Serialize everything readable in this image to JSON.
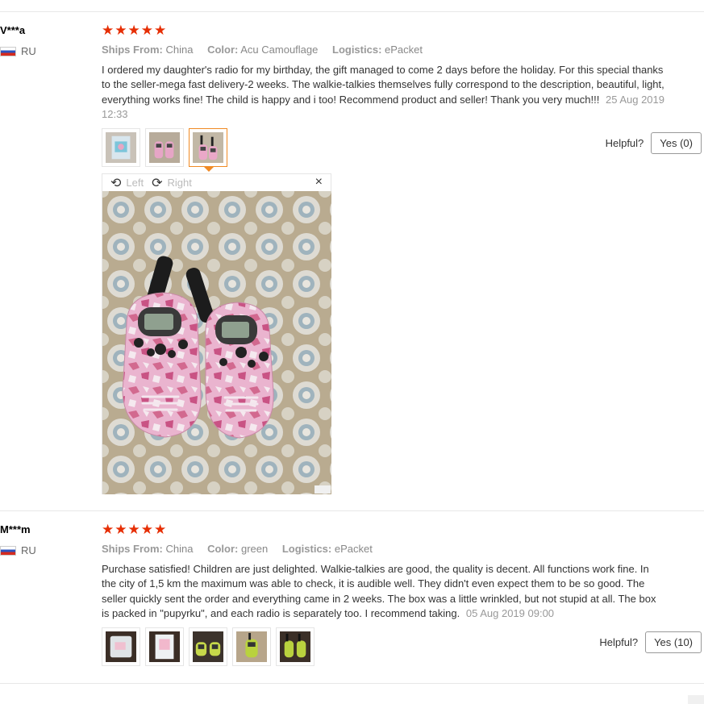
{
  "reviews": [
    {
      "user": "V***a",
      "country": "RU",
      "stars": "★★★★★",
      "ships_label": "Ships From:",
      "ships_value": "China",
      "color_label": "Color:",
      "color_value": "Acu Camouflage",
      "logistics_label": "Logistics:",
      "logistics_value": "ePacket",
      "text": "I ordered my daughter's radio for my birthday, the gift managed to come 2 days before the holiday. For this special thanks to the seller-mega fast delivery-2 weeks. The walkie-talkies themselves fully correspond to the description, beautiful, light, everything works fine! The child is happy and i too! Recommend product and seller! Thank you very much!!!",
      "date": "25 Aug 2019 12:33",
      "helpful_label": "Helpful?",
      "yes_label": "Yes (0)",
      "viewer": {
        "left_label": "Left",
        "right_label": "Right",
        "close_symbol": "×"
      }
    },
    {
      "user": "M***m",
      "country": "RU",
      "stars": "★★★★★",
      "ships_label": "Ships From:",
      "ships_value": "China",
      "color_label": "Color:",
      "color_value": "green",
      "logistics_label": "Logistics:",
      "logistics_value": "ePacket",
      "text": "Purchase satisfied! Children are just delighted. Walkie-talkies are good, the quality is decent. All functions work fine. In the city of 1,5 km the maximum was able to check, it is audible well. They didn't even expect them to be so good. The seller quickly sent the order and everything came in 2 weeks. The box was a little wrinkled, but not stupid at all. The box is packed in \"pupyrku\", and each radio is separately too. I recommend taking.",
      "date": "05 Aug 2019 09:00",
      "helpful_label": "Helpful?",
      "yes_label": "Yes (10)"
    }
  ],
  "colors": {
    "star": "#e62e04",
    "selected_thumb": "#f08a24"
  }
}
